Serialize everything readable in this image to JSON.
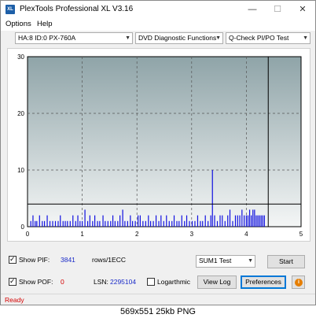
{
  "window": {
    "title": "PlexTools Professional XL V3.16",
    "icon_label": "XL",
    "min_label": "—",
    "max_label": "☐",
    "close_label": "✕"
  },
  "menu": {
    "options": "Options",
    "help": "Help"
  },
  "selectors": {
    "drive": "HA:8 ID:0  PX-760A",
    "function": "DVD Diagnostic Functions",
    "test": "Q-Check PI/PO Test",
    "arrow": "▼"
  },
  "chart_data": {
    "type": "bar",
    "x_ticks": [
      "0",
      "1",
      "2",
      "3",
      "4",
      "5"
    ],
    "y_ticks": [
      "0",
      "10",
      "20",
      "30"
    ],
    "xlim": [
      0,
      5
    ],
    "ylim": [
      0,
      30
    ],
    "grid": true,
    "threshold": 4,
    "end_marker": 4.4,
    "colors": {
      "bars": "#1010e0",
      "threshold": "#000000",
      "end_marker": "#000000",
      "bg_top": "#8fa4a8",
      "bg_bottom": "#f4f6f6"
    },
    "series": [
      {
        "x": [
          0.06,
          0.1,
          0.14,
          0.17,
          0.22,
          0.27,
          0.31,
          0.36,
          0.41,
          0.46,
          0.51,
          0.56,
          0.6,
          0.65,
          0.69,
          0.73,
          0.78,
          0.83,
          0.88,
          0.92,
          0.96,
          1.0,
          1.05,
          1.1,
          1.14,
          1.19,
          1.23,
          1.28,
          1.32,
          1.38,
          1.42,
          1.47,
          1.52,
          1.56,
          1.6,
          1.65,
          1.69,
          1.74,
          1.78,
          1.83,
          1.88,
          1.92,
          1.97,
          2.02,
          2.06,
          2.11,
          2.16,
          2.21,
          2.25,
          2.3,
          2.35,
          2.4,
          2.44,
          2.49,
          2.54,
          2.59,
          2.64,
          2.68,
          2.73,
          2.77,
          2.82,
          2.87,
          2.91,
          2.96,
          3.01,
          3.06,
          3.11,
          3.16,
          3.2,
          3.25,
          3.3,
          3.35,
          3.38,
          3.42,
          3.47,
          3.52,
          3.56,
          3.61,
          3.66,
          3.7,
          3.75,
          3.8,
          3.84,
          3.88,
          3.92,
          3.96,
          4.0,
          4.03,
          4.06,
          4.09,
          4.12,
          4.15,
          4.18,
          4.21,
          4.24,
          4.27,
          4.3,
          4.33
        ],
        "y": [
          1,
          2,
          1,
          1,
          2,
          1,
          1,
          2,
          1,
          1,
          1,
          1,
          2,
          1,
          1,
          1,
          1,
          2,
          1,
          2,
          1,
          1,
          3,
          1,
          2,
          1,
          2,
          1,
          1,
          2,
          1,
          1,
          1,
          2,
          1,
          1,
          2,
          3,
          1,
          1,
          2,
          1,
          1,
          2,
          2,
          1,
          1,
          2,
          1,
          1,
          2,
          1,
          2,
          1,
          2,
          1,
          1,
          2,
          1,
          1,
          2,
          1,
          2,
          1,
          1,
          1,
          2,
          1,
          1,
          2,
          1,
          2,
          10,
          2,
          1,
          2,
          2,
          1,
          2,
          3,
          1,
          2,
          2,
          2,
          3,
          2,
          2,
          2,
          3,
          2,
          3,
          3,
          2,
          2,
          2,
          2,
          2,
          2
        ]
      }
    ]
  },
  "controls": {
    "show_pif_label": "Show PIF:",
    "pif_value": "3841",
    "rows_label": "rows/1ECC",
    "show_pof_label": "Show POF:",
    "pof_value": "0",
    "lsn_label": "LSN:",
    "lsn_value": "2295104",
    "logarithmic_label": "Logarthmic",
    "sum_select": "SUM1 Test",
    "start_label": "Start",
    "view_log_label": "View Log",
    "preferences_label": "Preferences",
    "checkmark": "✓",
    "info_glyph": "i"
  },
  "status": {
    "text": "Ready"
  },
  "caption": "569x551  25kb  PNG"
}
